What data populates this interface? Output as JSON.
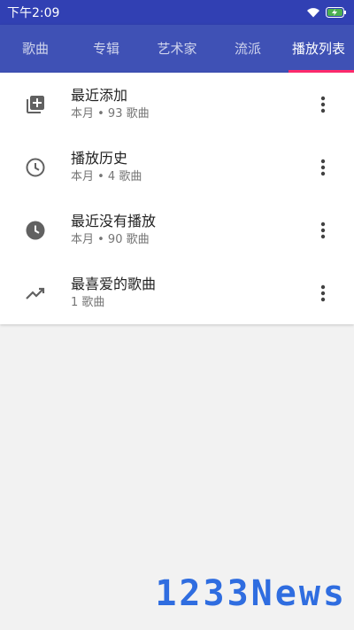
{
  "status_bar": {
    "time": "下午2:09"
  },
  "tabs": [
    {
      "label": "歌曲"
    },
    {
      "label": "专辑"
    },
    {
      "label": "艺术家"
    },
    {
      "label": "流派"
    },
    {
      "label": "播放列表",
      "active": true
    }
  ],
  "playlists": [
    {
      "title": "最近添加",
      "subtitle": "本月 • 93 歌曲",
      "icon": "playlist-add-icon"
    },
    {
      "title": "播放历史",
      "subtitle": "本月 • 4 歌曲",
      "icon": "history-clock-icon"
    },
    {
      "title": "最近没有播放",
      "subtitle": "本月 • 90 歌曲",
      "icon": "clock-filled-icon"
    },
    {
      "title": "最喜爱的歌曲",
      "subtitle": "1 歌曲",
      "icon": "trending-up-icon"
    }
  ],
  "watermark": "1233News",
  "colors": {
    "status_bar": "#3140b3",
    "tab_bar": "#3f51b5",
    "tab_indicator": "#ff2a6d",
    "watermark": "#2f6de0"
  }
}
